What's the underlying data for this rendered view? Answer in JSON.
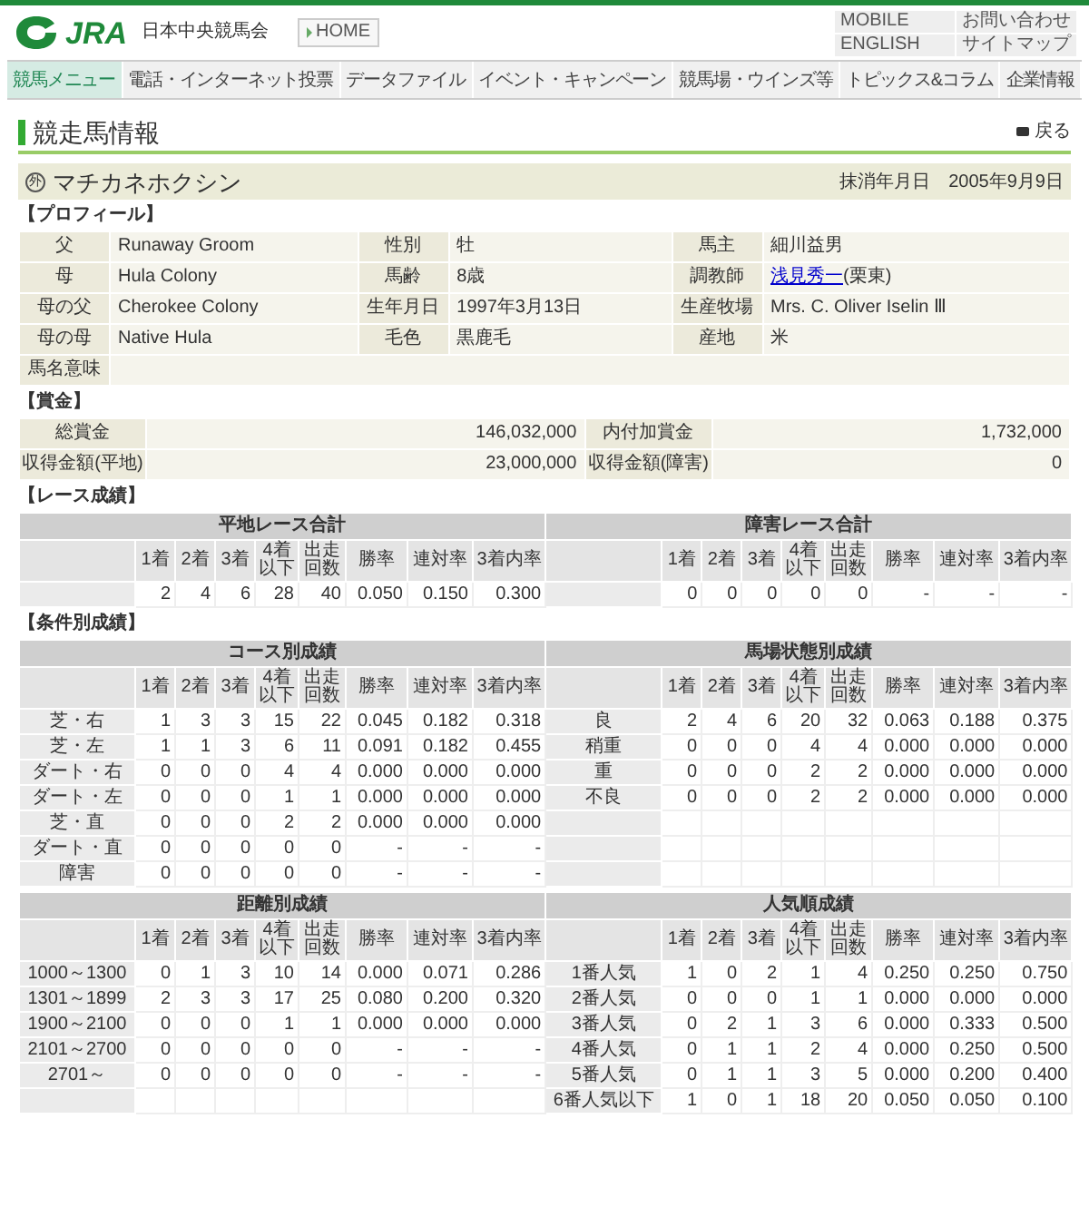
{
  "header": {
    "logo_text": "JRA",
    "org_name": "日本中央競馬会",
    "home_link": "HOME",
    "utility_links": [
      "MOBILE",
      "お問い合わせ",
      "ENGLISH",
      "サイトマップ"
    ]
  },
  "nav": [
    {
      "label": "競馬メニュー",
      "selected": true
    },
    {
      "label": "電話・インターネット投票",
      "selected": false
    },
    {
      "label": "データファイル",
      "selected": false
    },
    {
      "label": "イベント・キャンペーン",
      "selected": false
    },
    {
      "label": "競馬場・ウインズ等",
      "selected": false
    },
    {
      "label": "トピックス&コラム",
      "selected": false
    },
    {
      "label": "企業情報",
      "selected": false
    }
  ],
  "page_title": "競走馬情報",
  "back_link": "戻る",
  "horse": {
    "mark": "外",
    "name": "マチカネホクシン",
    "retired_label": "抹消年月日",
    "retired_date": "2005年9月9日"
  },
  "profile": {
    "heading": "【プロフィール】",
    "rows": [
      [
        {
          "label": "父",
          "value": "Runaway Groom"
        },
        {
          "label": "性別",
          "value": "牡"
        },
        {
          "label": "馬主",
          "value": "細川益男"
        }
      ],
      [
        {
          "label": "母",
          "value": "Hula Colony"
        },
        {
          "label": "馬齢",
          "value": "8歳"
        },
        {
          "label": "調教師",
          "link": "浅見秀一",
          "value": "(栗東)"
        }
      ],
      [
        {
          "label": "母の父",
          "value": "Cherokee Colony"
        },
        {
          "label": "生年月日",
          "value": "1997年3月13日"
        },
        {
          "label": "生産牧場",
          "value": "Mrs. C. Oliver Iselin Ⅲ"
        }
      ],
      [
        {
          "label": "母の母",
          "value": "Native Hula"
        },
        {
          "label": "毛色",
          "value": "黒鹿毛"
        },
        {
          "label": "産地",
          "value": "米"
        }
      ],
      [
        {
          "label": "馬名意味"
        }
      ]
    ]
  },
  "prize": {
    "heading": "【賞金】",
    "rows": [
      [
        {
          "label": "総賞金",
          "value": "146,032,000"
        },
        {
          "label": "内付加賞金",
          "value": "1,732,000"
        }
      ],
      [
        {
          "label": "収得金額(平地)",
          "value": "23,000,000"
        },
        {
          "label": "収得金額(障害)",
          "value": "0"
        }
      ]
    ]
  },
  "race_results": {
    "heading": "【レース成績】",
    "tables": [
      {
        "title": "平地レース合計",
        "columns": [
          "1着",
          "2着",
          "3着",
          "4着以下",
          "出走回数",
          "勝率",
          "連対率",
          "3着内率"
        ],
        "rows": [
          {
            "cells": [
              "2",
              "4",
              "6",
              "28",
              "40",
              "0.050",
              "0.150",
              "0.300"
            ]
          }
        ]
      },
      {
        "title": "障害レース合計",
        "columns": [
          "1着",
          "2着",
          "3着",
          "4着以下",
          "出走回数",
          "勝率",
          "連対率",
          "3着内率"
        ],
        "rows": [
          {
            "cells": [
              "0",
              "0",
              "0",
              "0",
              "0",
              "-",
              "-",
              "-"
            ]
          }
        ]
      }
    ]
  },
  "condition_results": {
    "heading": "【条件別成績】",
    "groups": [
      [
        {
          "title": "コース別成績",
          "columns": [
            "1着",
            "2着",
            "3着",
            "4着以下",
            "出走回数",
            "勝率",
            "連対率",
            "3着内率"
          ],
          "rows": [
            {
              "label": "芝・右",
              "cells": [
                "1",
                "3",
                "3",
                "15",
                "22",
                "0.045",
                "0.182",
                "0.318"
              ]
            },
            {
              "label": "芝・左",
              "cells": [
                "1",
                "1",
                "3",
                "6",
                "11",
                "0.091",
                "0.182",
                "0.455"
              ]
            },
            {
              "label": "ダート・右",
              "cells": [
                "0",
                "0",
                "0",
                "4",
                "4",
                "0.000",
                "0.000",
                "0.000"
              ]
            },
            {
              "label": "ダート・左",
              "cells": [
                "0",
                "0",
                "0",
                "1",
                "1",
                "0.000",
                "0.000",
                "0.000"
              ]
            },
            {
              "label": "芝・直",
              "cells": [
                "0",
                "0",
                "0",
                "2",
                "2",
                "0.000",
                "0.000",
                "0.000"
              ]
            },
            {
              "label": "ダート・直",
              "cells": [
                "0",
                "0",
                "0",
                "0",
                "0",
                "-",
                "-",
                "-"
              ]
            },
            {
              "label": "障害",
              "cells": [
                "0",
                "0",
                "0",
                "0",
                "0",
                "-",
                "-",
                "-"
              ]
            }
          ]
        },
        {
          "title": "馬場状態別成績",
          "columns": [
            "1着",
            "2着",
            "3着",
            "4着以下",
            "出走回数",
            "勝率",
            "連対率",
            "3着内率"
          ],
          "rows": [
            {
              "label": "良",
              "cells": [
                "2",
                "4",
                "6",
                "20",
                "32",
                "0.063",
                "0.188",
                "0.375"
              ]
            },
            {
              "label": "稍重",
              "cells": [
                "0",
                "0",
                "0",
                "4",
                "4",
                "0.000",
                "0.000",
                "0.000"
              ]
            },
            {
              "label": "重",
              "cells": [
                "0",
                "0",
                "0",
                "2",
                "2",
                "0.000",
                "0.000",
                "0.000"
              ]
            },
            {
              "label": "不良",
              "cells": [
                "0",
                "0",
                "0",
                "2",
                "2",
                "0.000",
                "0.000",
                "0.000"
              ]
            }
          ]
        }
      ],
      [
        {
          "title": "距離別成績",
          "columns": [
            "1着",
            "2着",
            "3着",
            "4着以下",
            "出走回数",
            "勝率",
            "連対率",
            "3着内率"
          ],
          "rows": [
            {
              "label": "1000～1300",
              "cells": [
                "0",
                "1",
                "3",
                "10",
                "14",
                "0.000",
                "0.071",
                "0.286"
              ]
            },
            {
              "label": "1301～1899",
              "cells": [
                "2",
                "3",
                "3",
                "17",
                "25",
                "0.080",
                "0.200",
                "0.320"
              ]
            },
            {
              "label": "1900～2100",
              "cells": [
                "0",
                "0",
                "0",
                "1",
                "1",
                "0.000",
                "0.000",
                "0.000"
              ]
            },
            {
              "label": "2101～2700",
              "cells": [
                "0",
                "0",
                "0",
                "0",
                "0",
                "-",
                "-",
                "-"
              ]
            },
            {
              "label": "2701～",
              "cells": [
                "0",
                "0",
                "0",
                "0",
                "0",
                "-",
                "-",
                "-"
              ]
            }
          ]
        },
        {
          "title": "人気順成績",
          "columns": [
            "1着",
            "2着",
            "3着",
            "4着以下",
            "出走回数",
            "勝率",
            "連対率",
            "3着内率"
          ],
          "rows": [
            {
              "label": "1番人気",
              "cells": [
                "1",
                "0",
                "2",
                "1",
                "4",
                "0.250",
                "0.250",
                "0.750"
              ]
            },
            {
              "label": "2番人気",
              "cells": [
                "0",
                "0",
                "0",
                "1",
                "1",
                "0.000",
                "0.000",
                "0.000"
              ]
            },
            {
              "label": "3番人気",
              "cells": [
                "0",
                "2",
                "1",
                "3",
                "6",
                "0.000",
                "0.333",
                "0.500"
              ]
            },
            {
              "label": "4番人気",
              "cells": [
                "0",
                "1",
                "1",
                "2",
                "4",
                "0.000",
                "0.250",
                "0.500"
              ]
            },
            {
              "label": "5番人気",
              "cells": [
                "0",
                "1",
                "1",
                "3",
                "5",
                "0.000",
                "0.200",
                "0.400"
              ]
            },
            {
              "label": "6番人気以下",
              "cells": [
                "1",
                "0",
                "1",
                "18",
                "20",
                "0.050",
                "0.050",
                "0.100"
              ]
            }
          ]
        }
      ]
    ]
  }
}
